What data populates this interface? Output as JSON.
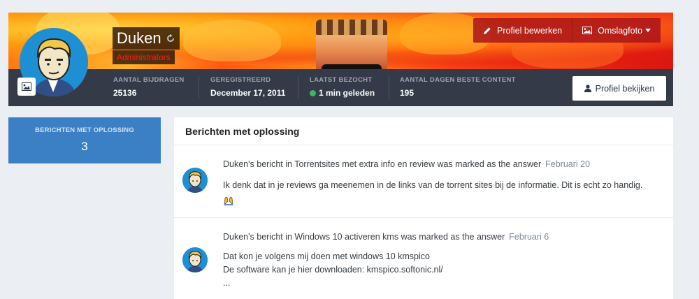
{
  "profile": {
    "name": "Duken",
    "group": "Administrators"
  },
  "actions": {
    "edit_profile": "Profiel bewerken",
    "cover_photo": "Omslagfoto",
    "view_profile": "Profiel bekijken"
  },
  "stats": [
    {
      "label": "AANTAL BIJDRAGEN",
      "value": "25136"
    },
    {
      "label": "GEREGISTREERD",
      "value": "December 17, 2011"
    },
    {
      "label": "LAATST BEZOCHT",
      "value": "1 min geleden"
    },
    {
      "label": "AANTAL DAGEN BESTE CONTENT",
      "value": "195"
    }
  ],
  "sidebar": {
    "label": "BERICHTEN MET OPLOSSING",
    "count": "3"
  },
  "main": {
    "title": "Berichten met oplossing",
    "items": [
      {
        "head": "Duken's bericht in Torrentsites met extra info en review was marked as the answer",
        "date": "Februari 20",
        "body": [
          "Ik denk dat in je reviews ga meenemen in de links van de torrent sites bij de informatie. Dit is echt zo handig."
        ]
      },
      {
        "head": "Duken's bericht in Windows 10 activeren kms was marked as the answer",
        "date": "Februari 6",
        "body": [
          "Dat kon je volgens mij doen met windows 10 kmspico",
          "De software kan je hier downloaden: kmspico.softonic.nl/",
          "..."
        ]
      }
    ]
  },
  "colors": {
    "statbar": "#343a48",
    "sidebar": "#3b7fc4",
    "accent_red": "#ff1a1a",
    "online": "#41b461"
  },
  "icons": [
    "image-icon",
    "refresh-icon",
    "pencil-icon",
    "photo-icon",
    "caret-down-icon",
    "user-icon",
    "praise-emoji-icon"
  ]
}
